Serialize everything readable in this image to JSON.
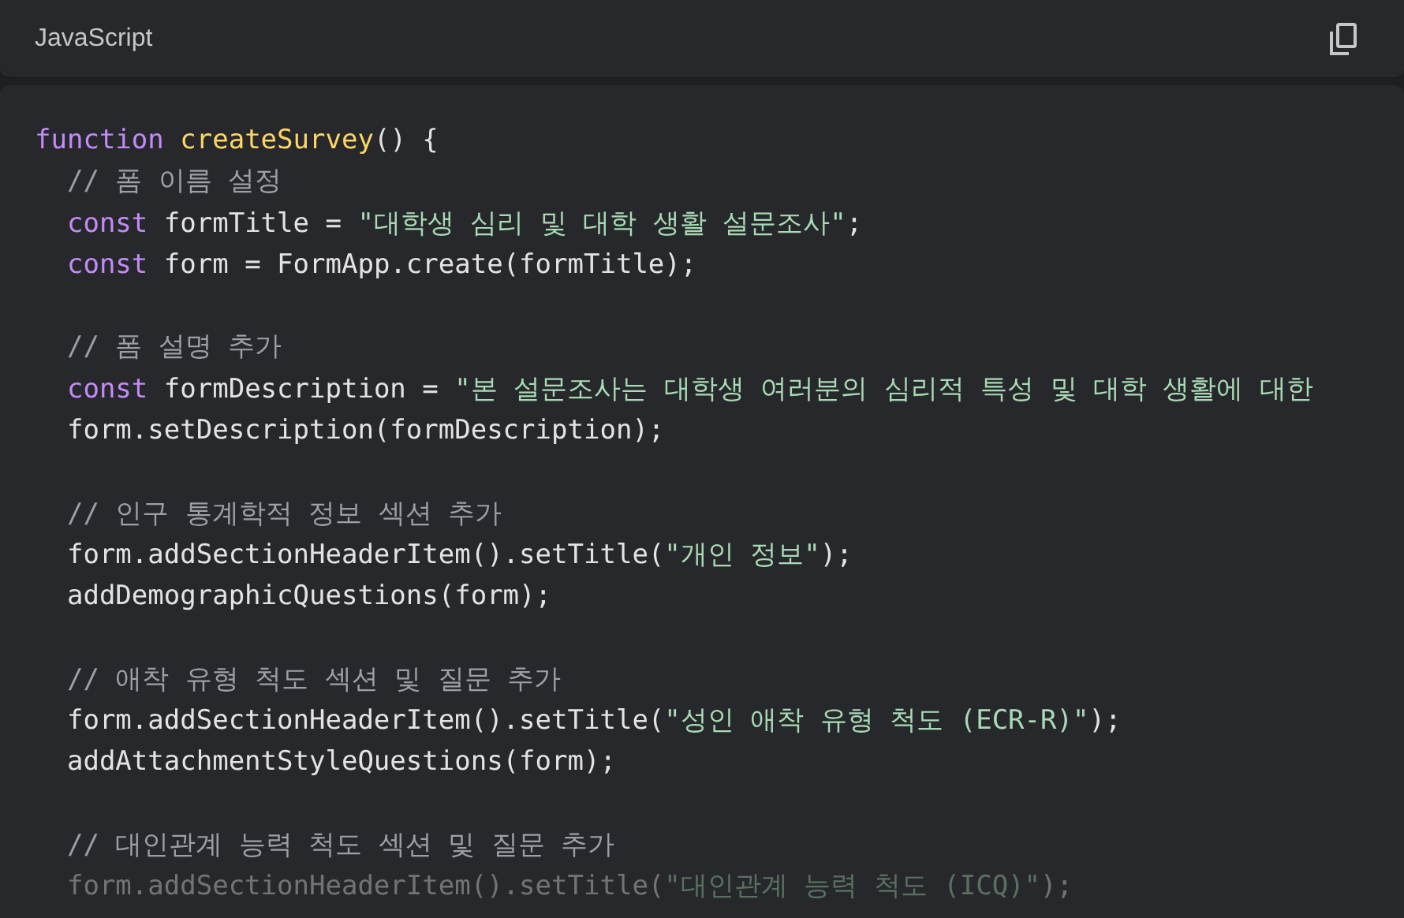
{
  "header": {
    "language": "JavaScript"
  },
  "code_lines": [
    {
      "kind": "code",
      "tokens": [
        {
          "kind": "keyword",
          "text": "function "
        },
        {
          "kind": "function",
          "text": "createSurvey"
        },
        {
          "kind": "plain",
          "text": "() {"
        }
      ]
    },
    {
      "kind": "code",
      "tokens": [
        {
          "kind": "comment",
          "text": "  // 폼 이름 설정"
        }
      ]
    },
    {
      "kind": "code",
      "tokens": [
        {
          "kind": "keyword",
          "text": "  const "
        },
        {
          "kind": "plain",
          "text": "formTitle = "
        },
        {
          "kind": "string",
          "text": "\"대학생 심리 및 대학 생활 설문조사\""
        },
        {
          "kind": "plain",
          "text": ";"
        }
      ]
    },
    {
      "kind": "code",
      "tokens": [
        {
          "kind": "keyword",
          "text": "  const "
        },
        {
          "kind": "plain",
          "text": "form = FormApp.create(formTitle);"
        }
      ]
    },
    {
      "kind": "blank"
    },
    {
      "kind": "code",
      "tokens": [
        {
          "kind": "comment",
          "text": "  // 폼 설명 추가"
        }
      ]
    },
    {
      "kind": "code",
      "tokens": [
        {
          "kind": "keyword",
          "text": "  const "
        },
        {
          "kind": "plain",
          "text": "formDescription = "
        },
        {
          "kind": "string",
          "text": "\"본 설문조사는 대학생 여러분의 심리적 특성 및 대학 생활에 대한"
        }
      ]
    },
    {
      "kind": "code",
      "tokens": [
        {
          "kind": "plain",
          "text": "  form.setDescription(formDescription);"
        }
      ]
    },
    {
      "kind": "blank"
    },
    {
      "kind": "code",
      "tokens": [
        {
          "kind": "comment",
          "text": "  // 인구 통계학적 정보 섹션 추가"
        }
      ]
    },
    {
      "kind": "code",
      "tokens": [
        {
          "kind": "plain",
          "text": "  form.addSectionHeaderItem().setTitle("
        },
        {
          "kind": "string",
          "text": "\"개인 정보\""
        },
        {
          "kind": "plain",
          "text": ");"
        }
      ]
    },
    {
      "kind": "code",
      "tokens": [
        {
          "kind": "plain",
          "text": "  addDemographicQuestions(form);"
        }
      ]
    },
    {
      "kind": "blank"
    },
    {
      "kind": "code",
      "tokens": [
        {
          "kind": "comment",
          "text": "  // 애착 유형 척도 섹션 및 질문 추가"
        }
      ]
    },
    {
      "kind": "code",
      "tokens": [
        {
          "kind": "plain",
          "text": "  form.addSectionHeaderItem().setTitle("
        },
        {
          "kind": "string",
          "text": "\"성인 애착 유형 척도 (ECR-R)\""
        },
        {
          "kind": "plain",
          "text": ");"
        }
      ]
    },
    {
      "kind": "code",
      "tokens": [
        {
          "kind": "plain",
          "text": "  addAttachmentStyleQuestions(form);"
        }
      ]
    },
    {
      "kind": "blank"
    },
    {
      "kind": "code",
      "tokens": [
        {
          "kind": "comment",
          "text": "  // 대인관계 능력 척도 섹션 및 질문 추가"
        }
      ]
    },
    {
      "kind": "code",
      "tokens": [
        {
          "kind": "plain",
          "text": "  form.addSectionHeaderItem().setTitle("
        },
        {
          "kind": "string",
          "text": "\"대인관계 능력 척도 (ICQ)\""
        },
        {
          "kind": "plain",
          "text": ");"
        }
      ]
    }
  ]
}
